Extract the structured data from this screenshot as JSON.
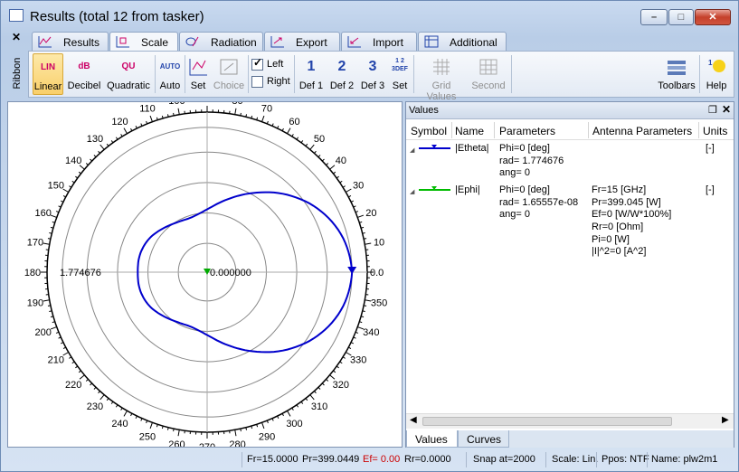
{
  "window": {
    "title": "Results (total 12 from tasker)",
    "min": "–",
    "max": "□",
    "close": "✕"
  },
  "ribbon_side": {
    "close": "✕",
    "label": "Ribbon"
  },
  "tabs": [
    {
      "label": "Results",
      "icon": "results-icon"
    },
    {
      "label": "Scale",
      "icon": "scale-icon"
    },
    {
      "label": "Radiation",
      "icon": "radiation-icon"
    },
    {
      "label": "Export",
      "icon": "export-icon"
    },
    {
      "label": "Import",
      "icon": "import-icon"
    },
    {
      "label": "Additional",
      "icon": "additional-icon"
    }
  ],
  "ribbon": {
    "linear": {
      "label": "Linear",
      "icon_text": "LIN"
    },
    "decibel": {
      "label": "Decibel",
      "icon_text": "dB"
    },
    "quadratic": {
      "label": "Quadratic",
      "icon_text": "QU"
    },
    "auto": {
      "label": "Auto",
      "icon_text": "AUTO"
    },
    "set1": {
      "label": "Set"
    },
    "choice": {
      "label": "Choice"
    },
    "left": {
      "label": "Left",
      "checked": true
    },
    "right": {
      "label": "Right",
      "checked": false
    },
    "def1": {
      "label": "Def 1",
      "icon_text": "1"
    },
    "def2": {
      "label": "Def 2",
      "icon_text": "2"
    },
    "def3": {
      "label": "Def 3",
      "icon_text": "3"
    },
    "set2": {
      "label": "Set",
      "icon_text": "1 2 3DEF"
    },
    "grid_values": {
      "label": "Grid Values"
    },
    "second": {
      "label": "Second"
    },
    "toolbars": {
      "label": "Toolbars"
    },
    "help": {
      "label": "Help"
    }
  },
  "plot": {
    "angle_labels": [
      "0.0",
      "10",
      "20",
      "30",
      "40",
      "50",
      "60",
      "70",
      "80",
      "90",
      "100",
      "110",
      "120",
      "130",
      "140",
      "150",
      "160",
      "170",
      "180",
      "190",
      "200",
      "210",
      "220",
      "230",
      "240",
      "250",
      "260",
      "270",
      "280",
      "290",
      "300",
      "310",
      "320",
      "330",
      "340",
      "350"
    ],
    "max_label": "1.774676",
    "center_label": "0.000000",
    "right_label": "0.0",
    "chart_data": {
      "type": "polar",
      "series": [
        {
          "name": "|Etheta|",
          "color": "#0000cc",
          "angles_deg": [
            0,
            15,
            30,
            45,
            60,
            75,
            90,
            105,
            120,
            135,
            150,
            165,
            180,
            195,
            210,
            225,
            240,
            255,
            270,
            285,
            300,
            315,
            330,
            345,
            360
          ],
          "radius": [
            1.774676,
            1.71,
            1.56,
            1.35,
            1.12,
            0.92,
            0.77,
            0.7,
            0.71,
            0.76,
            0.82,
            0.85,
            0.85,
            0.85,
            0.82,
            0.76,
            0.71,
            0.7,
            0.77,
            0.92,
            1.12,
            1.35,
            1.56,
            1.71,
            1.774676
          ]
        },
        {
          "name": "|Ephi|",
          "color": "#00aa00",
          "angles_deg": [
            0,
            90,
            180,
            270
          ],
          "radius": [
            0.0,
            0.0,
            0.0,
            0.0
          ]
        }
      ],
      "rmax": 2.2
    }
  },
  "values": {
    "header": "Values",
    "pin": "❐",
    "close": "✕",
    "columns": [
      "Symbol",
      "Name",
      "Parameters",
      "Antenna Parameters",
      "Units"
    ],
    "rows": [
      {
        "name": "|Etheta|",
        "color": "#0000cc",
        "params": [
          "Phi=0 [deg]",
          "rad= 1.774676",
          "ang= 0"
        ],
        "antenna": [],
        "units": "[-]"
      },
      {
        "name": "|Ephi|",
        "color": "#00bb00",
        "params": [
          "Phi=0 [deg]",
          "rad= 1.65557e-08",
          "ang= 0"
        ],
        "antenna": [
          "Fr=15 [GHz]",
          "Pr=399.045 [W]",
          "Ef=0 [W/W*100%]",
          "Rr=0 [Ohm]",
          "Pi=0 [W]",
          "|I|^2=0 [A^2]"
        ],
        "units": "[-]"
      }
    ],
    "bottom_tabs": [
      "Values",
      "Curves"
    ]
  },
  "status": {
    "fr": "Fr=15.0000",
    "pr": "Pr=399.0449",
    "ef": "Ef= 0.00",
    "rr": "Rr=0.0000",
    "snap": "Snap at=2000",
    "scale": "Scale: Lin.",
    "ppos": "Ppos: NTF",
    "name": "Name: plw2m1",
    "ef_color": "#cc0000"
  }
}
